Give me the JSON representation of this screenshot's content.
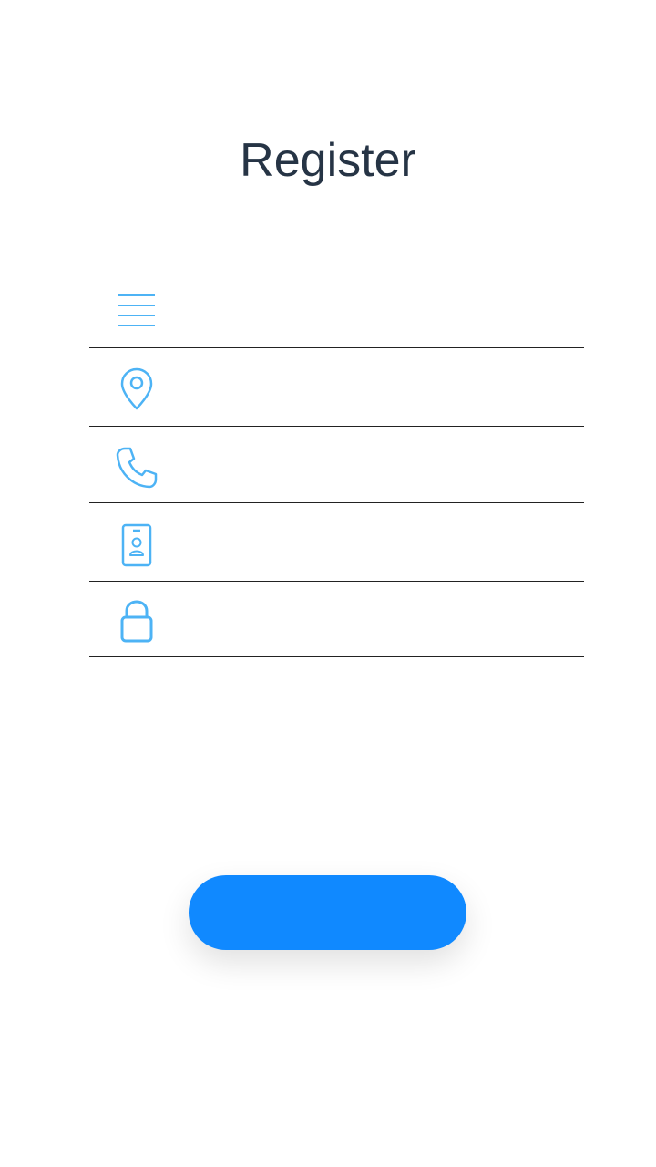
{
  "page": {
    "title": "Register"
  },
  "form": {
    "fields": [
      {
        "icon": "menu-lines-icon",
        "value": "",
        "placeholder": ""
      },
      {
        "icon": "location-pin-icon",
        "value": "",
        "placeholder": ""
      },
      {
        "icon": "phone-icon",
        "value": "",
        "placeholder": ""
      },
      {
        "icon": "id-badge-icon",
        "value": "",
        "placeholder": ""
      },
      {
        "icon": "lock-icon",
        "value": "",
        "placeholder": ""
      }
    ],
    "submit_label": ""
  },
  "colors": {
    "accent": "#1089ff",
    "icon": "#4db3f5",
    "title": "#263445",
    "divider": "#222222",
    "background": "#ffffff"
  }
}
